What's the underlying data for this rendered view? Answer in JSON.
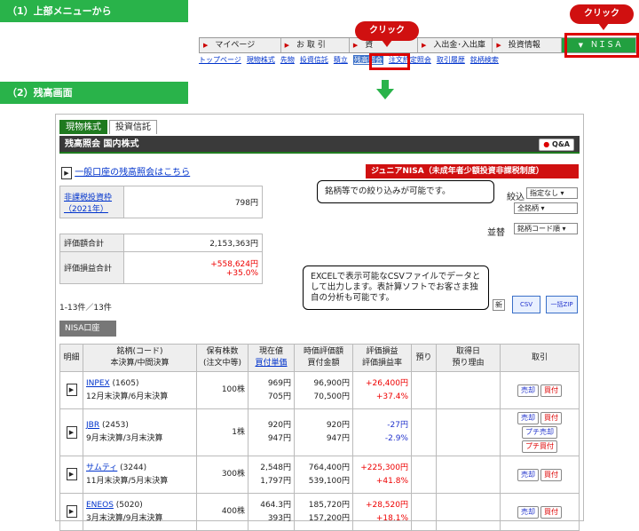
{
  "steps": {
    "s1": "（1）上部メニューから",
    "s2": "（2）残高画面"
  },
  "menu": {
    "items": [
      {
        "label": "マイページ"
      },
      {
        "label": "お 取 引"
      },
      {
        "label": "資"
      },
      {
        "label": "入出金･入出庫"
      },
      {
        "label": "投資情報"
      },
      {
        "label": "ＮＩＳＡ"
      }
    ],
    "sub": [
      "トップページ",
      "現物株式",
      "先物",
      "投資信託",
      "積立",
      "残高照会",
      "注文約定照会",
      "取引履歴",
      "銘柄検索"
    ]
  },
  "callouts": {
    "click1": "クリック",
    "click2": "クリック"
  },
  "panel": {
    "tabs": [
      "現物株式",
      "投資信託"
    ],
    "title": "残高照会 国内株式",
    "qa": "Q&A",
    "general_link": "一般口座の残高照会はこちら",
    "badge": "ジュニアNISA（未成年者少額投資非課税制度）",
    "limit_label": "非課税投資枠（2021年）",
    "limit_value": "798円",
    "valuation_label": "評価額合計",
    "valuation_value": "2,153,363円",
    "pl_label": "評価損益合計",
    "pl_value": "+558,624円",
    "pl_rate": "+35.0%",
    "count": "1-13件／13件",
    "nisa_tab": "NISA口座",
    "filter_label": "絞込",
    "filter_value": "指定なし",
    "filter_value2": "全銘柄",
    "sort_label": "並替",
    "sort_value": "銘柄コード順",
    "csv": "CSV",
    "zip": "一括ZIP",
    "new_short": "新"
  },
  "notes": {
    "filter": "銘柄等での絞り込みが可能です。",
    "csv": "EXCELで表示可能なCSVファイルでデータとして出力します。表計算ソフトでお客さま独自の分析も可能です。"
  },
  "table": {
    "headers": {
      "detail": "明細",
      "name": "銘柄(コード)",
      "name2": "本決算/中間決算",
      "qty": "保有株数",
      "qty2": "(注文中等)",
      "price": "現在値",
      "price2": "買付単価",
      "val": "時価評価額",
      "val2": "買付金額",
      "pl": "評価損益",
      "pl2": "評価損益率",
      "dep": "預り",
      "acq": "取得日",
      "acq2": "預り理由",
      "trade": "取引"
    },
    "rows": [
      {
        "name": "INPEX",
        "code": "(1605)",
        "fy": "12月末決算/6月末決算",
        "qty": "100株",
        "price": "969円",
        "cost": "705円",
        "val": "96,900円",
        "buyamt": "70,500円",
        "pl": "+26,400円",
        "rate": "+37.4%",
        "sign": "pos",
        "buttons": [
          "売却",
          "買付"
        ]
      },
      {
        "name": "JBR",
        "code": "(2453)",
        "fy": "9月末決算/3月末決算",
        "qty": "1株",
        "price": "920円",
        "cost": "947円",
        "val": "920円",
        "buyamt": "947円",
        "pl": "-27円",
        "rate": "-2.9%",
        "sign": "neg",
        "buttons": [
          "売却",
          "買付",
          "プチ売却",
          "プチ買付"
        ]
      },
      {
        "name": "サムティ",
        "code": "(3244)",
        "fy": "11月末決算/5月末決算",
        "qty": "300株",
        "price": "2,548円",
        "cost": "1,797円",
        "val": "764,400円",
        "buyamt": "539,100円",
        "pl": "+225,300円",
        "rate": "+41.8%",
        "sign": "pos",
        "buttons": [
          "売却",
          "買付"
        ]
      },
      {
        "name": "ENEOS",
        "code": "(5020)",
        "fy": "3月末決算/9月末決算",
        "qty": "400株",
        "price": "464.3円",
        "cost": "393円",
        "val": "185,720円",
        "buyamt": "157,200円",
        "pl": "+28,520円",
        "rate": "+18.1%",
        "sign": "pos",
        "buttons": [
          "売却",
          "買付"
        ]
      }
    ]
  },
  "colors": {
    "green": "#29b34a",
    "red": "#d01010"
  }
}
